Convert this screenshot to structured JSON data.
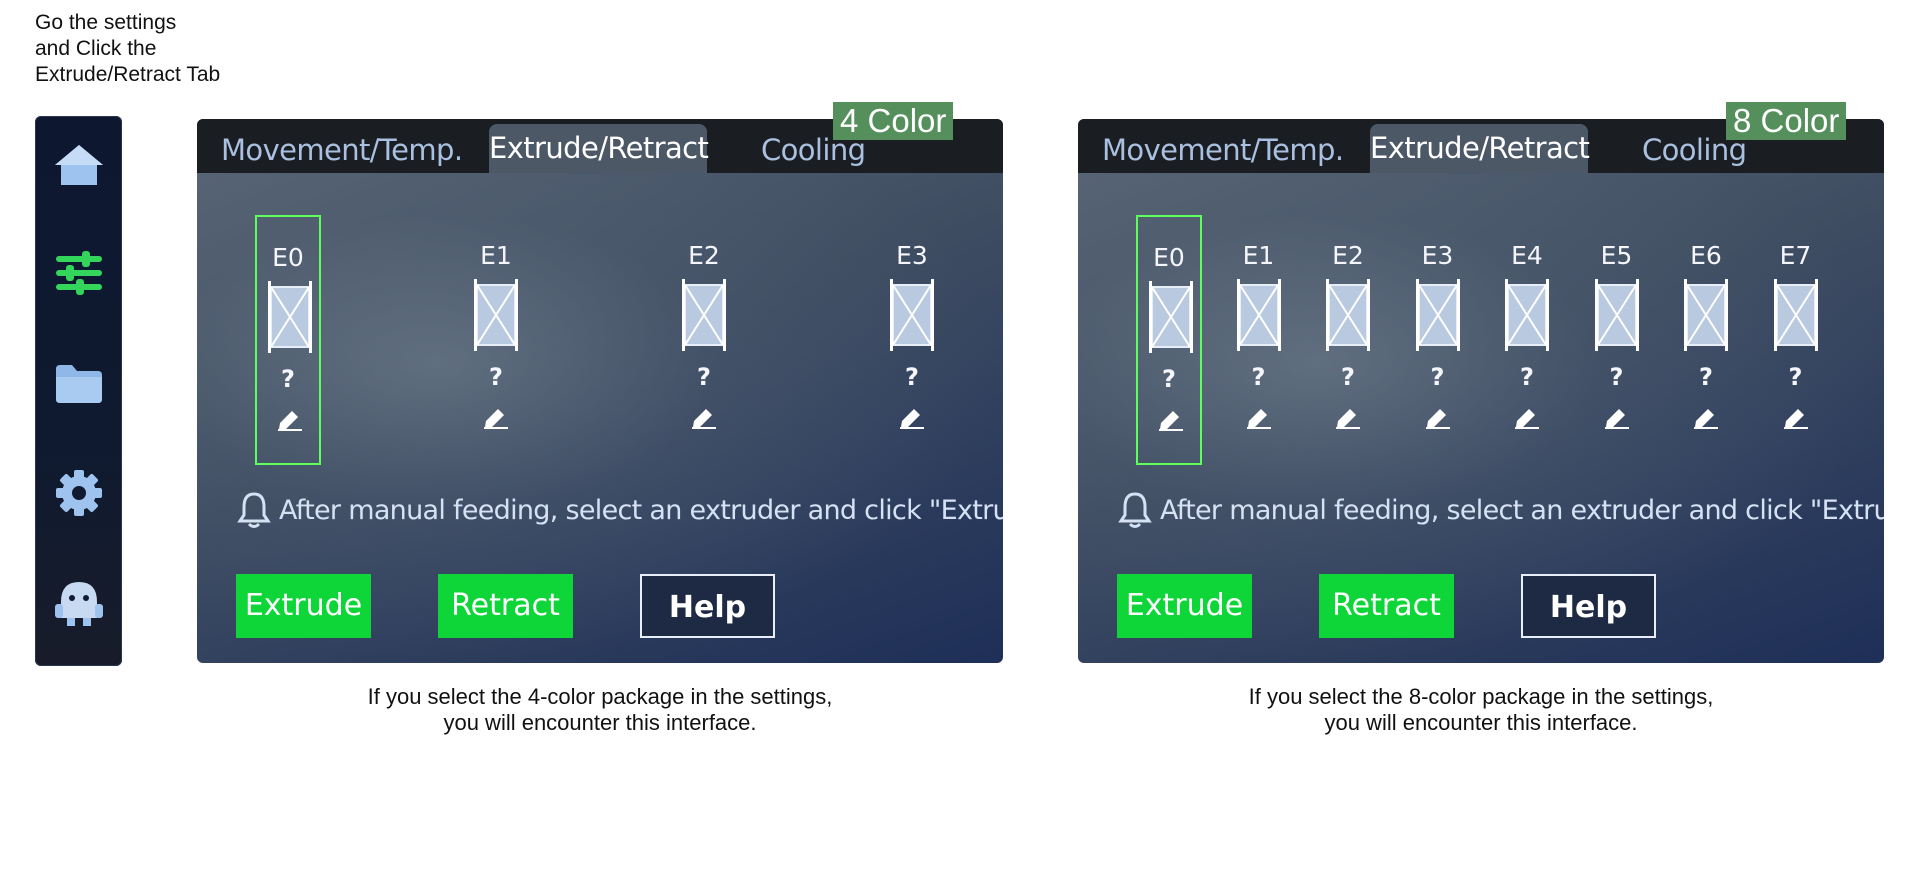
{
  "intro": {
    "line1": "Go the settings",
    "line2": "and Click the",
    "line3": "Extrude/Retract Tab"
  },
  "sidebar": {
    "items": [
      {
        "icon": "home-icon"
      },
      {
        "icon": "sliders-icon",
        "active": true
      },
      {
        "icon": "folder-icon"
      },
      {
        "icon": "gear-icon"
      },
      {
        "icon": "robot-icon"
      }
    ],
    "active_color": "#33d65a"
  },
  "screens": [
    {
      "badge": "4 Color",
      "tabs": {
        "movement": "Movement/Temp.",
        "extrude": "Extrude/Retract",
        "cooling": "Cooling"
      },
      "extruders": [
        {
          "label": "E0",
          "value": "?",
          "selected": true
        },
        {
          "label": "E1",
          "value": "?"
        },
        {
          "label": "E2",
          "value": "?"
        },
        {
          "label": "E3",
          "value": "?"
        }
      ],
      "notice": "After manual feeding, select an extruder and click \"Extrude\".",
      "buttons": {
        "extrude": "Extrude",
        "retract": "Retract",
        "help": "Help"
      },
      "caption": {
        "line1": "If you select the 4-color package in the settings,",
        "line2": "you will encounter this interface."
      }
    },
    {
      "badge": "8 Color",
      "tabs": {
        "movement": "Movement/Temp.",
        "extrude": "Extrude/Retract",
        "cooling": "Cooling"
      },
      "extruders": [
        {
          "label": "E0",
          "value": "?",
          "selected": true
        },
        {
          "label": "E1",
          "value": "?"
        },
        {
          "label": "E2",
          "value": "?"
        },
        {
          "label": "E3",
          "value": "?"
        },
        {
          "label": "E4",
          "value": "?"
        },
        {
          "label": "E5",
          "value": "?"
        },
        {
          "label": "E6",
          "value": "?"
        },
        {
          "label": "E7",
          "value": "?"
        }
      ],
      "notice": "After manual feeding, select an extruder and click \"Extrude\".",
      "buttons": {
        "extrude": "Extrude",
        "retract": "Retract",
        "help": "Help"
      },
      "caption": {
        "line1": "If you select the 8-color package in the settings,",
        "line2": "you will encounter this interface."
      }
    }
  ],
  "colors": {
    "selected_border": "#5dff5d",
    "button_green": "#0fd638",
    "badge_green": "#55905c"
  }
}
